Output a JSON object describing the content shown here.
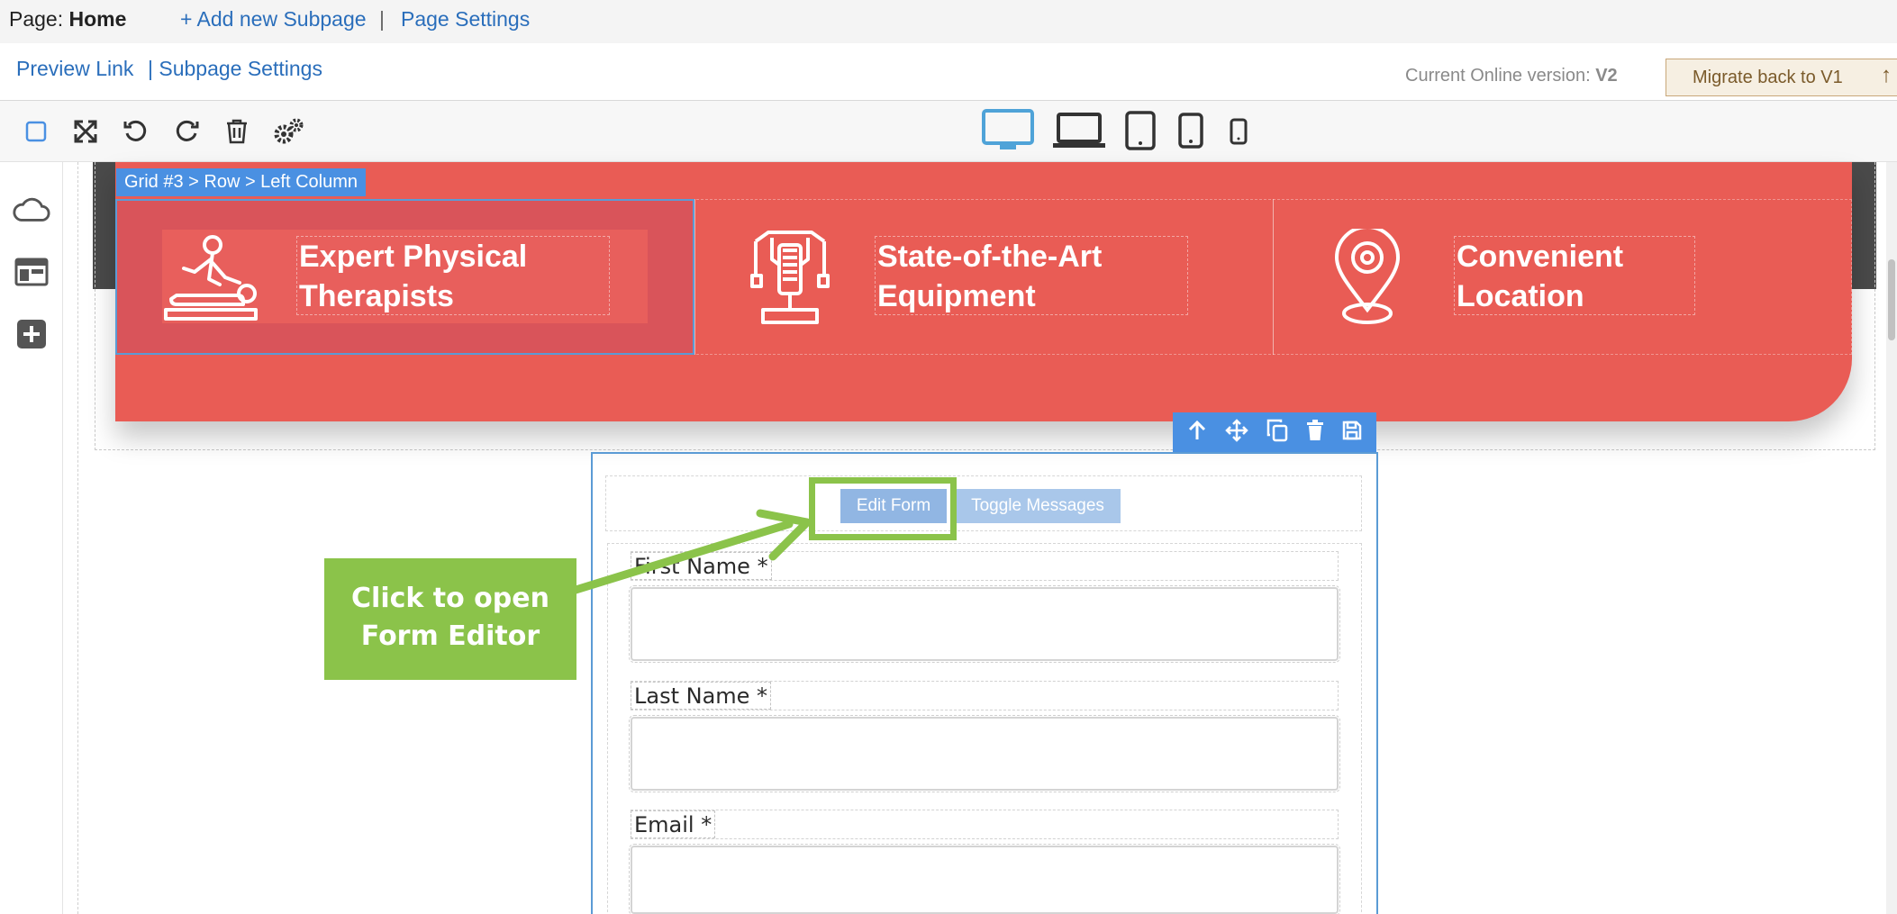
{
  "topbar": {
    "page_prefix": "Page: ",
    "page_name": "Home",
    "add_subpage": "+ Add new Subpage",
    "separator": "|",
    "page_settings": "Page Settings"
  },
  "subbar": {
    "preview_link": "Preview Link",
    "subpage_settings": "| Subpage Settings",
    "version_label": "Current Online version: ",
    "version_value": "V2",
    "migrate_button": "Migrate back to V1",
    "migrate_arrow": "↑"
  },
  "toolbar": {
    "icons": [
      "select-icon",
      "fullscreen-icon",
      "undo-icon",
      "redo-icon",
      "trash-icon",
      "settings-icon"
    ],
    "devices": [
      "desktop-icon",
      "laptop-icon",
      "tablet-icon",
      "tablet-small-icon",
      "mobile-icon"
    ],
    "active_device": "desktop-icon"
  },
  "sidebar": {
    "icons": [
      "cloud-icon",
      "layout-icon",
      "add-icon"
    ]
  },
  "breadcrumb": "Grid #3 > Row > Left Column",
  "features": [
    {
      "line1": "Expert Physical",
      "line2": "Therapists",
      "icon": "massage-therapist-icon"
    },
    {
      "line1": "State-of-the-Art",
      "line2": "Equipment",
      "icon": "gym-machine-icon"
    },
    {
      "line1": "Convenient",
      "line2": "Location",
      "icon": "location-pin-icon"
    }
  ],
  "form_tools": [
    "move-up-icon",
    "drag-move-icon",
    "duplicate-icon",
    "delete-icon",
    "save-icon"
  ],
  "form": {
    "edit_form": "Edit Form",
    "toggle_messages": "Toggle Messages",
    "fields": [
      {
        "label": "First Name *"
      },
      {
        "label": "Last Name *"
      },
      {
        "label": "Email *"
      }
    ]
  },
  "callout": {
    "line1": "Click to open",
    "line2": "Form Editor"
  },
  "colors": {
    "accent_blue": "#4a90e2",
    "feature_red": "#e95c55",
    "callout_green": "#8bc34a",
    "link_blue": "#2a6ebb"
  }
}
